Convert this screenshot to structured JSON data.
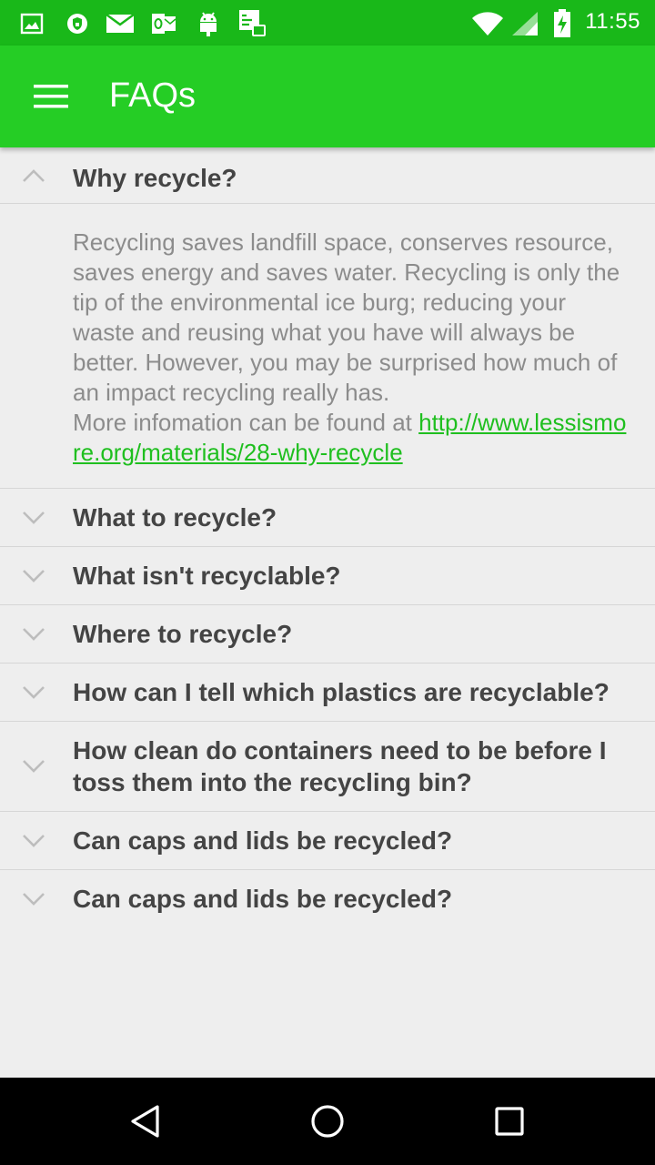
{
  "status_bar": {
    "time": "11:55",
    "icons": [
      "image-icon",
      "shield-icon",
      "mail-icon",
      "outlook-icon",
      "android-icon",
      "tasks-icon",
      "wifi-icon",
      "signal-icon",
      "battery-charging-icon"
    ]
  },
  "app_bar": {
    "title": "FAQs",
    "menu_icon": "hamburger-menu-icon"
  },
  "faqs": [
    {
      "question": "Why recycle?",
      "expanded": true,
      "answer": "Recycling saves landfill space, conserves resource, saves energy and saves water. Recycling is only the tip of the environmental ice burg; reducing your waste and reusing what you have will always be better. However, you may be surprised how much of an impact recycling really has.",
      "more_prefix": "More infomation can be found at ",
      "link": "http://www.lessismore.org/materials/28-why-recycle"
    },
    {
      "question": "What to recycle?",
      "expanded": false
    },
    {
      "question": "What isn't recyclable?",
      "expanded": false
    },
    {
      "question": "Where to recycle?",
      "expanded": false
    },
    {
      "question": "How can I tell which plastics are recyclable?",
      "expanded": false
    },
    {
      "question": "How clean do containers need to be before I toss them into the recycling bin?",
      "expanded": false
    },
    {
      "question": "Can caps and lids be recycled?",
      "expanded": false
    },
    {
      "question": "Can caps and lids be recycled?",
      "expanded": false
    }
  ],
  "nav_bar": {
    "back_icon": "back-triangle-icon",
    "home_icon": "home-circle-icon",
    "recents_icon": "recents-square-icon"
  },
  "colors": {
    "status_bar": "#19b819",
    "app_bar": "#25cd25",
    "link": "#1fbf1f",
    "background": "#eeeeee"
  }
}
